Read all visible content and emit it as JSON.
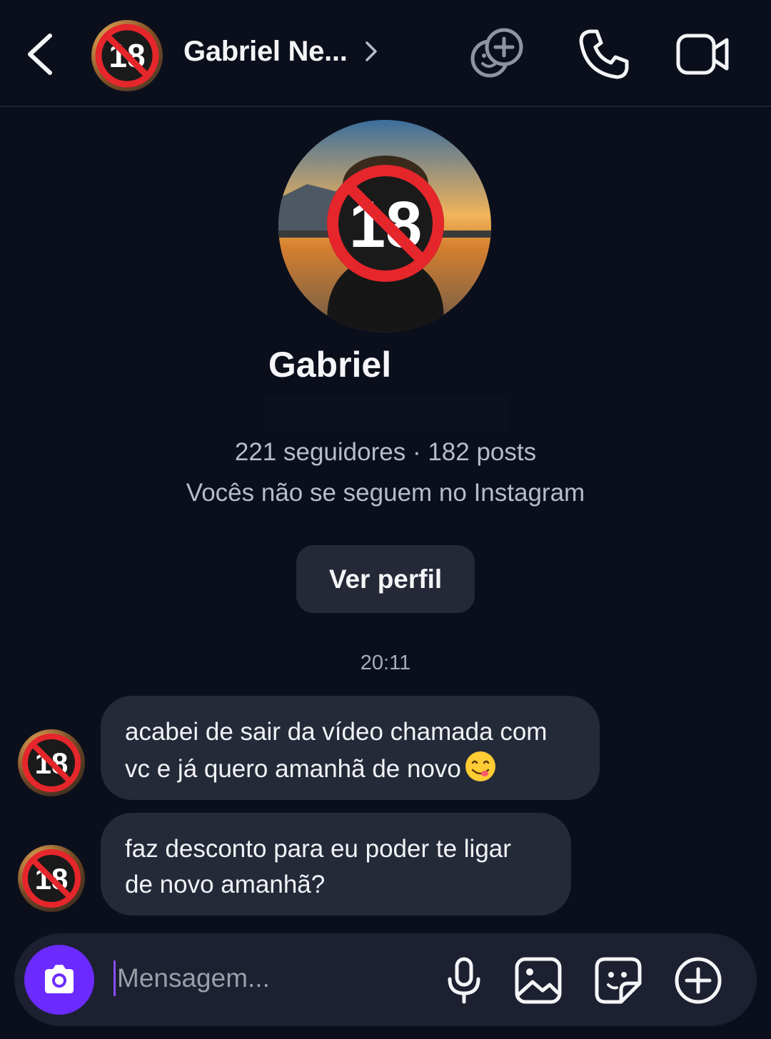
{
  "header": {
    "name": "Gabriel Ne...",
    "icons": [
      "back-icon",
      "effects-icon",
      "phone-icon",
      "video-icon"
    ]
  },
  "profile": {
    "name": "Gabriel",
    "stats": "221 seguidores · 182 posts",
    "follow_status": "Vocês não se seguem no Instagram",
    "view_profile_label": "Ver perfil"
  },
  "conversation": {
    "timestamp": "20:11",
    "messages": [
      {
        "line1": "acabei de sair da vídeo chamada com",
        "line2": "vc e já quero amanhã de novo"
      },
      {
        "line1": "faz desconto para eu poder te ligar",
        "line2": "de novo amanhã?"
      }
    ]
  },
  "composer": {
    "placeholder": "Mensagem..."
  },
  "badge": {
    "text": "18",
    "ring_color": "#e5262b"
  },
  "colors": {
    "background": "#0b0f1c",
    "bubble": "#252a39",
    "accent": "#6b2bff"
  }
}
